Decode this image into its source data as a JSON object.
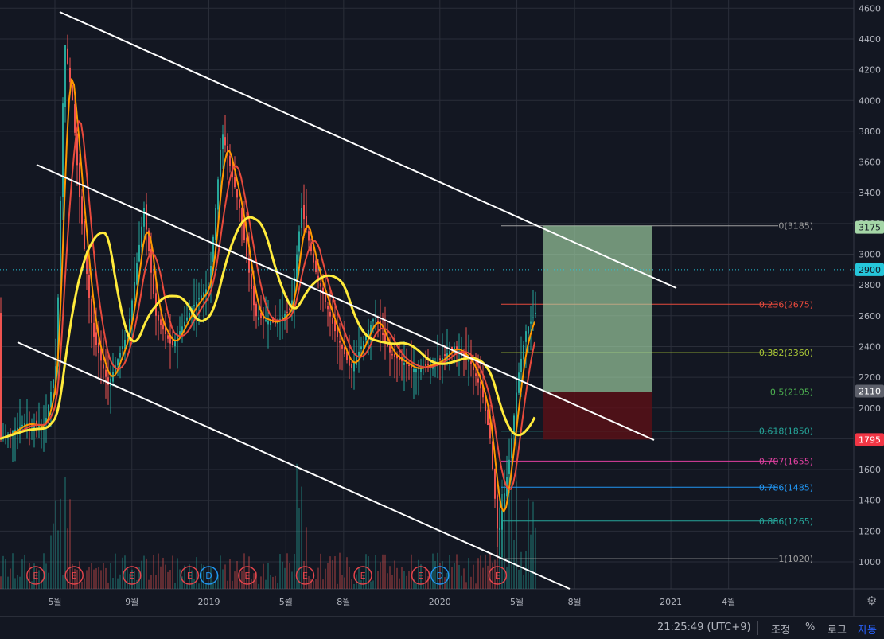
{
  "chart_data": {
    "type": "candlestick",
    "y_axis": {
      "scale": "linear",
      "ylim": [
        800,
        4600
      ],
      "ticks": [
        "1000",
        "1200",
        "1400",
        "1600",
        "1800",
        "2000",
        "2200",
        "2400",
        "2600",
        "2800",
        "3000",
        "3200",
        "3400",
        "3600",
        "3800",
        "4000",
        "4200",
        "4400",
        "4600"
      ],
      "tick_values": [
        1000,
        1200,
        1400,
        1600,
        1800,
        2000,
        2200,
        2400,
        2600,
        2800,
        3000,
        3200,
        3400,
        3600,
        3800,
        4000,
        4200,
        4400,
        4600
      ]
    },
    "x_axis": {
      "labels": [
        "5월",
        "9월",
        "2019",
        "5월",
        "8월",
        "2020",
        "5월",
        "8월",
        "2021",
        "4월"
      ],
      "dates": [
        "2018-05",
        "2018-09",
        "2019-01",
        "2019-05",
        "2019-08",
        "2020-01",
        "2020-05",
        "2020-08",
        "2021-01",
        "2021-04"
      ]
    },
    "price_labels": [
      {
        "text": "3175",
        "value": 3175,
        "color": "#a5d6a7",
        "text_color": "#131722"
      },
      {
        "text": "2900",
        "value": 2900,
        "color": "#26c6da",
        "text_color": "#131722"
      },
      {
        "text": "2110",
        "value": 2110,
        "color": "#5d606b",
        "text_color": "#ffffff"
      },
      {
        "text": "1795",
        "value": 1795,
        "color": "#f23645",
        "text_color": "#ffffff"
      }
    ],
    "fibonacci": [
      {
        "label": "0(3185)",
        "value": 3185,
        "color": "#9e9e9e"
      },
      {
        "label": "0.236(2675)",
        "value": 2675,
        "color": "#e84a3c"
      },
      {
        "label": "0.382(2360)",
        "value": 2360,
        "color": "#a8c536"
      },
      {
        "label": "0.5(2105)",
        "value": 2105,
        "color": "#4caf50"
      },
      {
        "label": "0.618(1850)",
        "value": 1850,
        "color": "#26a69a"
      },
      {
        "label": "0.707(1655)",
        "value": 1655,
        "color": "#e040a0"
      },
      {
        "label": "0.786(1485)",
        "value": 1485,
        "color": "#2196f3"
      },
      {
        "label": "0.886(1265)",
        "value": 1265,
        "color": "#26a69a"
      },
      {
        "label": "1(1020)",
        "value": 1020,
        "color": "#9e9e9e"
      }
    ],
    "events": [
      "E",
      "E",
      "E",
      "E",
      "D",
      "E",
      "E",
      "E",
      "E",
      "D",
      "E"
    ],
    "event_dates": [
      "2018-04",
      "2018-06",
      "2018-09",
      "2018-12",
      "2019-01",
      "2019-03",
      "2019-06",
      "2019-09",
      "2019-12",
      "2020-01",
      "2020-04"
    ],
    "event_colors": {
      "E": "#e5444b",
      "D": "#2196f3"
    },
    "colors": {
      "up": "#26a69a",
      "down": "#ef5350",
      "background": "#131722",
      "grid": "#2a2e39",
      "channel": "#ffffff",
      "ma_yellow": "#ffeb3b",
      "ma_orange": "#ff9800",
      "ma_red": "#e84a3c",
      "profit_zone": "#a5d6a7",
      "loss_zone": "#5d1017"
    }
  },
  "status_bar": {
    "clock": "21:25:49 (UTC+9)",
    "adjust": "조정",
    "percent": "%",
    "log": "로그",
    "auto": "자동"
  }
}
